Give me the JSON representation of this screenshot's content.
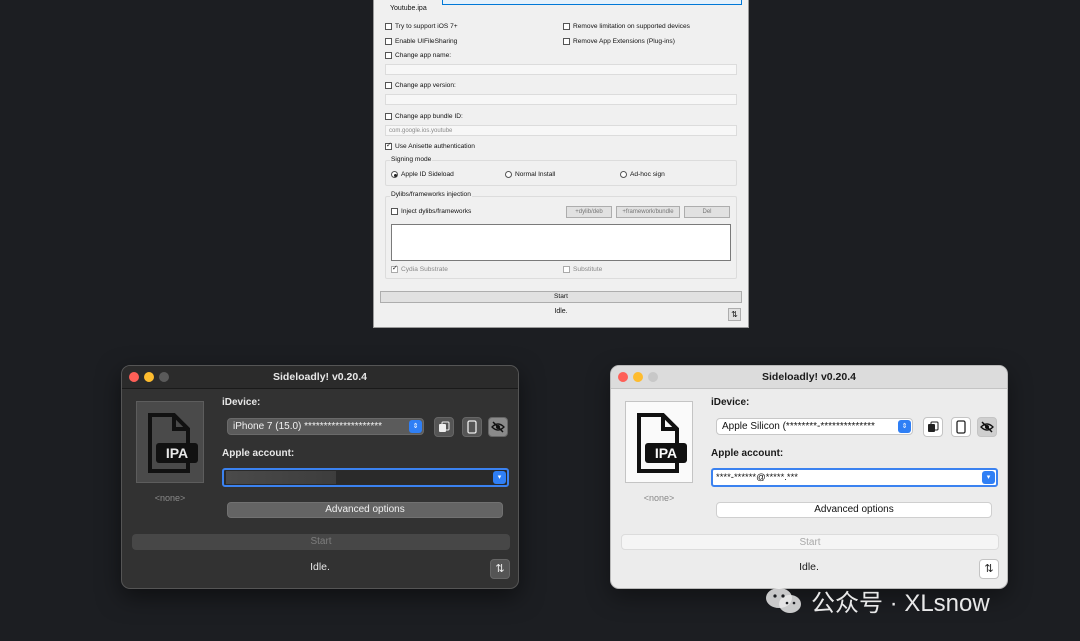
{
  "top_window": {
    "ipa_file": "Youtube.ipa",
    "options": {
      "support_ios7": "Try to support iOS 7+",
      "remove_limitation": "Remove limitation on supported devices",
      "enable_uifilesharing": "Enable UIFileSharing",
      "remove_app_extensions": "Remove App Extensions (Plug-ins)",
      "change_app_name": "Change app name:",
      "change_app_version": "Change app version:",
      "change_bundle_id": "Change app bundle ID:",
      "bundle_id_placeholder": "com.google.ios.youtube",
      "use_anisette": "Use Anisette authentication"
    },
    "signing_mode": {
      "title": "Signing mode",
      "options": [
        "Apple ID Sideload",
        "Normal Install",
        "Ad-hoc sign"
      ],
      "selected": "Apple ID Sideload"
    },
    "injection": {
      "title": "Dylibs/frameworks injection",
      "inject_label": "Inject dylibs/frameworks",
      "add_dylib": "+dylib/deb",
      "add_framework": "+framework/bundle",
      "del": "Del",
      "cydia_substrate": "Cydia Substrate",
      "substitute": "Substitute"
    },
    "start": "Start",
    "status": "Idle.",
    "sort_icon": "⇅"
  },
  "dark_window": {
    "title": "Sideloadly! v0.20.4",
    "ipa_icon_text": "IPA",
    "none_label": "<none>",
    "idevice_label": "iDevice:",
    "idevice_value": "iPhone 7 (15.0) ********************",
    "apple_account_label": "Apple account:",
    "apple_account_value": "",
    "advanced_options": "Advanced options",
    "start": "Start",
    "status": "Idle.",
    "sort_icon": "⇅"
  },
  "light_window": {
    "title": "Sideloadly! v0.20.4",
    "ipa_icon_text": "IPA",
    "none_label": "<none>",
    "idevice_label": "iDevice:",
    "idevice_value": "Apple Silicon (********-**************",
    "apple_account_label": "Apple account:",
    "apple_account_value": "****-******@*****.***",
    "advanced_options": "Advanced options",
    "start": "Start",
    "status": "Idle.",
    "sort_icon": "⇅"
  },
  "watermark": {
    "text": "公众号 · XLsnow"
  },
  "colors": {
    "background": "#1c1e22",
    "accent_blue": "#2f7ff5",
    "traffic_red": "#fe5f57",
    "traffic_yellow": "#febc2e"
  }
}
